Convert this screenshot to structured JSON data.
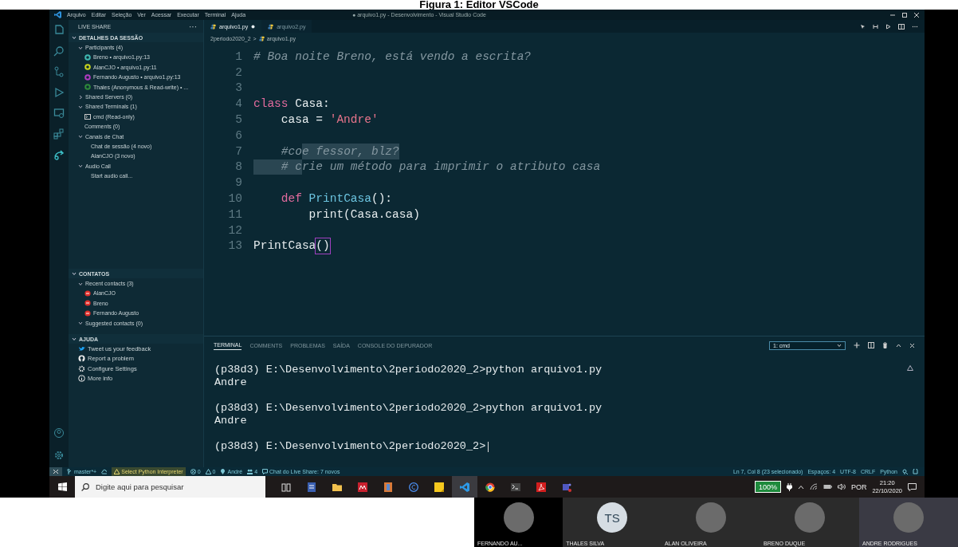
{
  "caption": "Figura 1: Editor VSCode",
  "menu": [
    "Arquivo",
    "Editar",
    "Seleção",
    "Ver",
    "Acessar",
    "Executar",
    "Terminal",
    "Ajuda"
  ],
  "window_title": "● arquivo1.py - Desenvolvimento - Visual Studio Code",
  "sidebar": {
    "title": "LIVE SHARE",
    "more": "···",
    "sections": [
      {
        "label": "DETALHES DA SESSÃO",
        "expanded": true,
        "children": [
          {
            "label": "Participants (4)",
            "kind": "group",
            "expanded": true,
            "children": [
              {
                "label": "Breno • arquivo1.py:13",
                "kind": "participant",
                "color": "#3fb8b0"
              },
              {
                "label": "AlanCJO • arquivo1.py:11",
                "kind": "participant",
                "color": "#c8d61e"
              },
              {
                "label": "Fernando Augusto • arquivo1.py:13",
                "kind": "participant",
                "color": "#b03cc0"
              },
              {
                "label": "Thales (Anonymous & Read-write) • ...",
                "kind": "participant",
                "color": "#2e8a3a"
              }
            ]
          },
          {
            "label": "Shared Servers (0)",
            "kind": "group",
            "expanded": false
          },
          {
            "label": "Shared Terminals (1)",
            "kind": "group",
            "expanded": true,
            "children": [
              {
                "label": "cmd (Read-only)",
                "kind": "terminal"
              }
            ]
          },
          {
            "label": "Comments (0)",
            "kind": "item"
          },
          {
            "label": "Canais de Chat",
            "kind": "group",
            "expanded": true,
            "children": [
              {
                "label": "Chat de sessão (4 novo)",
                "kind": "item"
              },
              {
                "label": "AlanCJO (3 novo)",
                "kind": "item"
              }
            ]
          },
          {
            "label": "Audio Call",
            "kind": "group",
            "expanded": true,
            "children": [
              {
                "label": "Start audio call...",
                "kind": "item"
              }
            ]
          }
        ]
      },
      {
        "label": "CONTATOS",
        "expanded": true,
        "children": [
          {
            "label": "Recent contacts (3)",
            "kind": "group",
            "expanded": true,
            "children": [
              {
                "label": "AlanCJO",
                "kind": "contact"
              },
              {
                "label": "Breno",
                "kind": "contact"
              },
              {
                "label": "Fernando Augusto",
                "kind": "contact"
              }
            ]
          },
          {
            "label": "Suggested contacts (0)",
            "kind": "group",
            "expanded": true
          }
        ]
      },
      {
        "label": "AJUDA",
        "expanded": true,
        "children": [
          {
            "label": "Tweet us your feedback",
            "kind": "bird"
          },
          {
            "label": "Report a problem",
            "kind": "octocat"
          },
          {
            "label": "Configure Settings",
            "kind": "gear"
          },
          {
            "label": "More info",
            "kind": "info"
          }
        ]
      }
    ]
  },
  "tabs": [
    {
      "label": "arquivo1.py",
      "selected": true,
      "modified": true
    },
    {
      "label": "arquivo2.py",
      "selected": false,
      "modified": false
    }
  ],
  "breadcrumb": [
    "2periodo2020_2",
    ">",
    "arquivo1.py"
  ],
  "code": [
    {
      "number": "1",
      "tokens": [
        {
          "kind": "comment",
          "text": "# Boa noite Breno, está vendo a escrita?",
          "selected": false
        }
      ]
    },
    {
      "number": "2"
    },
    {
      "number": "3"
    },
    {
      "number": "4",
      "tokens": [
        {
          "kind": "keyword",
          "text": "class",
          "selected": false
        },
        {
          "kind": "plain",
          "text": " Casa:",
          "selected": false
        }
      ]
    },
    {
      "number": "5",
      "tokens": [
        {
          "kind": "plain",
          "text": "    casa = ",
          "selected": false
        },
        {
          "kind": "string",
          "text": "'Andre'",
          "selected": false
        }
      ]
    },
    {
      "number": "6"
    },
    {
      "number": "7",
      "tokens": [
        {
          "kind": "comment",
          "text": "    #co",
          "selected": false
        },
        {
          "kind": "comment",
          "text": "e fessor, blz?",
          "selected": true
        }
      ]
    },
    {
      "number": "8",
      "tokens": [
        {
          "kind": "comment",
          "text": "    # c",
          "selected": true
        },
        {
          "kind": "comment",
          "text": "rie um método para imprimir o atributo casa",
          "selected": false
        }
      ]
    },
    {
      "number": "9"
    },
    {
      "number": "10",
      "tokens": [
        {
          "kind": "keyword",
          "text": "    def",
          "selected": false
        },
        {
          "kind": "function",
          "text": " PrintCasa",
          "selected": false
        },
        {
          "kind": "plain",
          "text": "():",
          "selected": false
        }
      ]
    },
    {
      "number": "11",
      "tokens": [
        {
          "kind": "plain",
          "text": "        print(Casa.casa)",
          "selected": false
        }
      ]
    },
    {
      "number": "12"
    },
    {
      "number": "13",
      "tokens": [
        {
          "kind": "plain",
          "text": "PrintCasa",
          "selected": false
        },
        {
          "kind": "bracket",
          "text": "()",
          "selected": false
        }
      ]
    }
  ],
  "panel_tabs": [
    {
      "label": "TERMINAL",
      "selected": true
    },
    {
      "label": "COMMENTS",
      "selected": false
    },
    {
      "label": "PROBLEMAS",
      "selected": false
    },
    {
      "label": "SAÍDA",
      "selected": false
    },
    {
      "label": "CONSOLE DO DEPURADOR",
      "selected": false
    }
  ],
  "terminal_select": "1: cmd",
  "terminal": [
    {
      "kind": "prompt",
      "text": "(p38d3) E:\\Desenvolvimento\\2periodo2020_2>python arquivo1.py"
    },
    {
      "kind": "output",
      "text": "Andre"
    },
    {
      "kind": "prompt",
      "text": "(p38d3) E:\\Desenvolvimento\\2periodo2020_2>python arquivo1.py"
    },
    {
      "kind": "output",
      "text": "Andre"
    },
    {
      "kind": "prompt",
      "text": "(p38d3) E:\\Desenvolvimento\\2periodo2020_2>"
    }
  ],
  "status_left": [
    {
      "kind": "branch",
      "text": "master*+"
    },
    {
      "kind": "sync"
    },
    {
      "kind": "interpreter",
      "text": "Select Python Interpreter"
    },
    {
      "kind": "errors",
      "text": "0"
    },
    {
      "kind": "warnings",
      "text": "0"
    },
    {
      "kind": "user",
      "text": "André"
    },
    {
      "kind": "people",
      "text": "4"
    },
    {
      "kind": "chat",
      "text": "Chat do Live Share: 7 novos"
    }
  ],
  "status_right": [
    "Ln 7, Col 8 (23 selecionado)",
    "Espaços: 4",
    "UTF-8",
    "CRLF",
    "Python"
  ],
  "taskbar": {
    "search_placeholder": "Digite aqui para pesquisar",
    "battery": "100%",
    "language": "POR",
    "time": "21:20",
    "date": "22/10/2020"
  },
  "call": [
    {
      "name": "FERNANDO AU...",
      "kind": "photo",
      "selected": false
    },
    {
      "name": "THALES SILVA",
      "kind": "initials",
      "initials": "TS",
      "selected": false
    },
    {
      "name": "ALAN OLIVEIRA",
      "kind": "photo",
      "selected": false
    },
    {
      "name": "BRENO DUQUE",
      "kind": "photo",
      "selected": false
    },
    {
      "name": "ANDRE RODRIGUES",
      "kind": "photo",
      "selected": true
    }
  ]
}
